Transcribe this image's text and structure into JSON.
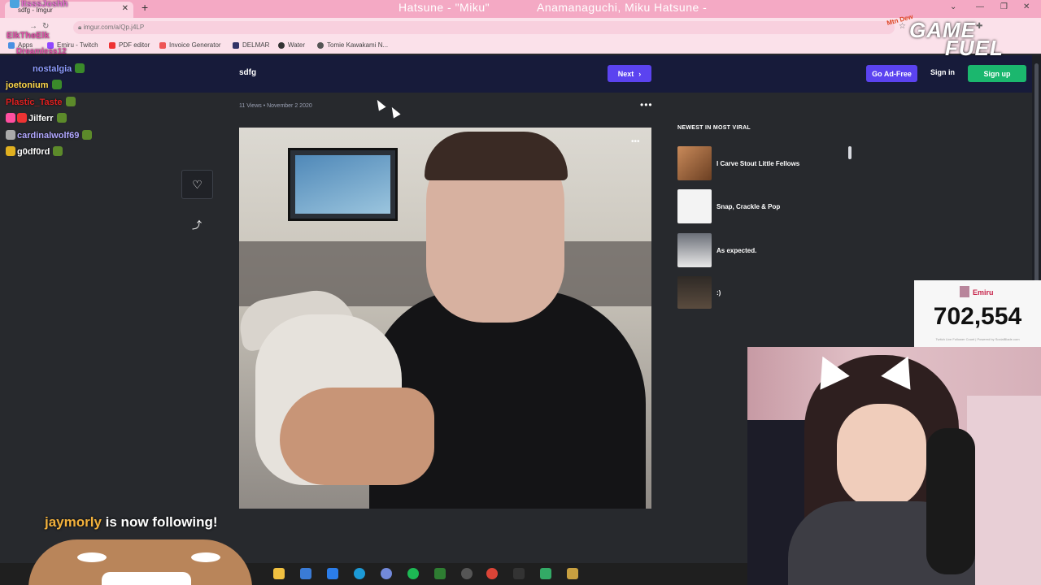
{
  "browser": {
    "tab_title": "sdfg - Imgur",
    "address": "imgur.com/a/Qp.j4LP",
    "now_playing_song": "Hatsune - \"Miku\"",
    "now_playing_artist": "Anamanaguchi, Miku Hatsune -",
    "bookmarks": [
      "Apps",
      "Emiru - Twitch",
      "PDF editor",
      "Invoice Generator",
      "DELMAR",
      "Water",
      "Tomie Kawakami N..."
    ]
  },
  "imgur": {
    "post_title": "sdfg",
    "next_label": "Next",
    "go_ad_free": "Go Ad-Free",
    "sign_in": "Sign in",
    "sign_up": "Sign up",
    "meta": "11 Views • November 2 2020",
    "newest_heading": "NEWEST IN MOST VIRAL",
    "newest_items": [
      {
        "label": "I Carve Stout Little Fellows"
      },
      {
        "label": "Snap, Crackle & Pop"
      },
      {
        "label": "As expected."
      },
      {
        "label": ":)"
      }
    ]
  },
  "chat": [
    {
      "user": "ItsssJoshh",
      "color": "#e76bd0"
    },
    {
      "user": "Dreamless12",
      "color": "#e04fa8"
    },
    {
      "user": "ElkTheElk",
      "color": "#e04fa8"
    },
    {
      "user": "nostalgia",
      "color": "#8e9cff"
    },
    {
      "user": "joetonium",
      "color": "#ffd84a"
    },
    {
      "user": "Plastic_Taste",
      "color": "#e02020"
    },
    {
      "user": "Jilferr",
      "color": "#ffffff"
    },
    {
      "user": "cardinalwolf69",
      "color": "#b1a7ff"
    },
    {
      "user": "g0df0rd",
      "color": "#ffffff"
    }
  ],
  "follower_counter": {
    "name": "Emiru",
    "count": "702,554",
    "sub": "Twitch Live Follower Count | Powered by SocialBlade.com"
  },
  "follow_alert": {
    "user": "jaymorly",
    "text": " is now following!"
  },
  "overlay_logo": {
    "line1": "GAME",
    "line2": "FUEL",
    "brand": "Mtn Dew"
  },
  "colors": {
    "imgur_header": "#171b3a",
    "accent_purple": "#5b43f0",
    "signup_green": "#1bb76e",
    "follow_user": "#f2b13c"
  }
}
